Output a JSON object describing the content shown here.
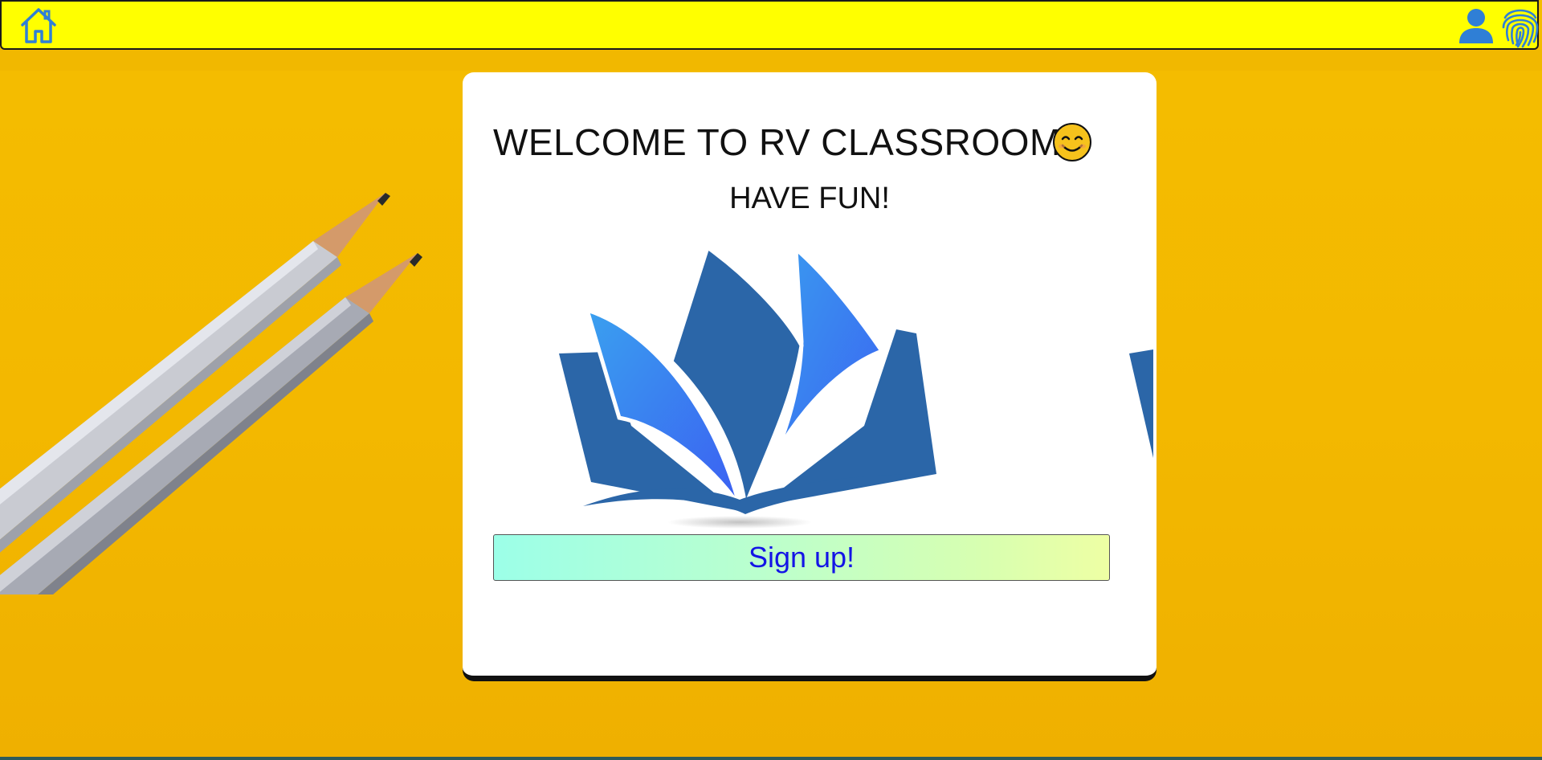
{
  "navbar": {
    "home_icon": "home-icon",
    "user_icon": "user-icon",
    "fingerprint_icon": "fingerprint-icon",
    "colors": {
      "background": "#ffff00",
      "icon": "#2f7fd6"
    }
  },
  "background": {
    "color": "#f4bd00",
    "decoration": "pencils"
  },
  "card": {
    "title": "WELCOME TO RV CLASSROOM!",
    "title_emoji": "smiling-face-icon",
    "subtitle": "HAVE FUN!",
    "image": "open-book-logo",
    "signup_label": "Sign up!",
    "colors": {
      "button_text": "#1414e6",
      "book_dark": "#2b66a8",
      "book_light": "#3aa0ef"
    }
  }
}
